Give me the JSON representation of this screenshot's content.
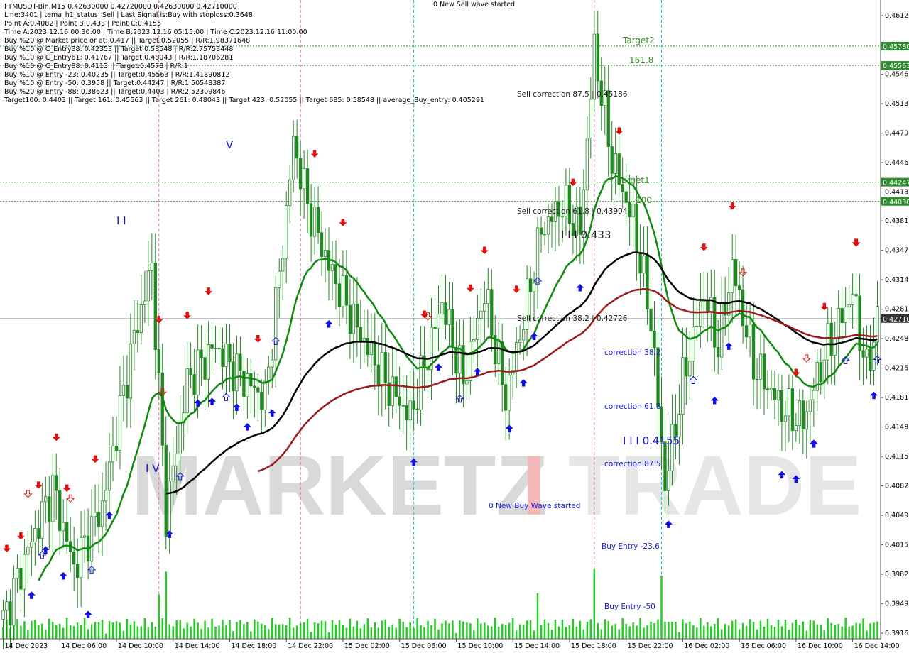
{
  "info_lines": [
    "FTMUSDT-Bin,M15  0.42630000 0.42720000 0.42630000 0.42710000",
    "Line:3401  | tema_h1_status: Sell  | Last Signal is:Buy with stoploss:0.3648",
    "Point A:0.4082 | Point B:0.433 | Point C:0.4155",
    "Time A:2023.12.16 00:30:00  | Time B:2023.12.16 05:15:00  | Time C:2023.12.16 11:00:00",
    "Buy %20 @ Market price or at: 0.417  || Target:0.52055  | R/R:1.98371648",
    "Buy %10 @ C_Entry38: 0.42353  || Target:0.58548  | R/R:2.75753448",
    "Buy %10 @ C_Entry61: 0.41767  || Target:0.48043  | R/R:1.18706281",
    "Buy %10 @ C_Entry88: 0.4113  || Target:0.4578  | R/R:1",
    "Buy %10 @ Entry -23: 0.40235  || Target:0.45563  | R/R:1.41890812",
    "Buy %10 @ Entry -50: 0.3958  || Target:0.44247  | R/R:1.50548387",
    "Buy %20 @ Entry -88: 0.38623  || Target:0.4403  | R/R:2.52309846",
    "Target100: 0.4403  || Target 161: 0.45563  || Target 261: 0.48043  || Target 423: 0.52055  || Target 685: 0.58548  || average_Buy_entry: 0.405291"
  ],
  "annotations": {
    "wave_sell": "0 New Sell wave started",
    "wave_buy": "0 New Buy Wave started",
    "target2": "Target2",
    "target2_level": "161.8",
    "target1": "Target1",
    "target1_level": "100",
    "sell_corr_875": "Sell correction 87.5 | 0.45186",
    "sell_corr_618": "Sell correction 61.8 | 0.43904",
    "sell_corr_382": "Sell correction 38.2 | 0.42726",
    "point_b": "I I I 0.433",
    "point_c": "I I I 0.4155",
    "corr_382": "correction 38.2",
    "corr_618": "correction 61.8",
    "corr_875": "correction 87.5",
    "buy_entry_23": "Buy Entry -23.6",
    "buy_entry_50": "Buy Entry -50",
    "wave_iv": "I V",
    "wave_ii": "I I",
    "wave_v": "V"
  },
  "watermark": {
    "text_dark": "MARKETZ",
    "text_red": "I",
    "text_light": "TRADE"
  },
  "colors": {
    "background": "#ffffff",
    "grid": "#d9d9d9",
    "bull_candle": "#1f8a1f",
    "bear_candle": "#1f8a1f",
    "volume": "#22cc22",
    "ema_green": "#0e8a0e",
    "ma_black": "#000000",
    "ma_red": "#9a1c1c",
    "target_line": "#2e8b2e",
    "price_tag": "#2e8b2e",
    "current_tag": "#333333",
    "buy_arrow": "#1010e0",
    "sell_arrow": "#e01010",
    "vline_pink": "#e06aa0",
    "vline_cyan": "#00cccc"
  },
  "chart_data": {
    "type": "candlestick",
    "symbol": "FTMUSDT-Bin",
    "timeframe": "M15",
    "price_axis": {
      "ylim": [
        0.391,
        0.463
      ],
      "tick_labels": [
        "0.46125",
        "0.45795",
        "0.45463",
        "0.45131",
        "0.44799",
        "0.44467",
        "0.44135",
        "0.43811",
        "0.43479",
        "0.43147",
        "0.42815",
        "0.42483",
        "0.42151",
        "0.41819",
        "0.41487",
        "0.41155",
        "0.40823",
        "0.40491",
        "0.40159",
        "0.39827",
        "0.39495",
        "0.39163"
      ],
      "tick_values": [
        0.46125,
        0.45795,
        0.45463,
        0.45131,
        0.44799,
        0.44467,
        0.44135,
        0.43811,
        0.43479,
        0.43147,
        0.42815,
        0.42483,
        0.42151,
        0.41819,
        0.41487,
        0.41155,
        0.40823,
        0.40491,
        0.40159,
        0.39827,
        0.39495,
        0.39163
      ]
    },
    "price_tags": [
      {
        "label": "0.45780",
        "value": 0.4578,
        "kind": "target"
      },
      {
        "label": "0.45563",
        "value": 0.45563,
        "kind": "target"
      },
      {
        "label": "0.44247",
        "value": 0.44247,
        "kind": "target"
      },
      {
        "label": "0.44030",
        "value": 0.4403,
        "kind": "target"
      },
      {
        "label": "0.42710",
        "value": 0.4271,
        "kind": "current"
      }
    ],
    "time_axis": {
      "labels": [
        "14 Dec 2023",
        "14 Dec 06:00",
        "14 Dec 10:00",
        "14 Dec 14:00",
        "14 Dec 18:00",
        "14 Dec 22:00",
        "15 Dec 02:00",
        "15 Dec 06:00",
        "15 Dec 10:00",
        "15 Dec 14:00",
        "15 Dec 18:00",
        "15 Dec 22:00",
        "16 Dec 02:00",
        "16 Dec 06:00",
        "16 Dec 10:00",
        "16 Dec 14:00"
      ],
      "positions_bars": [
        0,
        16,
        32,
        48,
        64,
        80,
        96,
        112,
        128,
        144,
        160,
        176,
        192,
        208,
        224,
        240
      ],
      "bars_visible": 248
    },
    "key_points": {
      "start": 0.393,
      "peaks": [
        {
          "bar": 7,
          "v": 0.401
        },
        {
          "bar": 14,
          "v": 0.408
        },
        {
          "bar": 20,
          "v": 0.399
        },
        {
          "bar": 28,
          "v": 0.406
        },
        {
          "bar": 37,
          "v": 0.425
        },
        {
          "bar": 42,
          "v": 0.433
        },
        {
          "bar": 46,
          "v": 0.405
        },
        {
          "bar": 52,
          "v": 0.42
        },
        {
          "bar": 60,
          "v": 0.424
        },
        {
          "bar": 66,
          "v": 0.421
        },
        {
          "bar": 74,
          "v": 0.418
        },
        {
          "bar": 80,
          "v": 0.439
        },
        {
          "bar": 82,
          "v": 0.447
        },
        {
          "bar": 86,
          "v": 0.44
        },
        {
          "bar": 92,
          "v": 0.433
        },
        {
          "bar": 100,
          "v": 0.426
        },
        {
          "bar": 108,
          "v": 0.42
        },
        {
          "bar": 115,
          "v": 0.416
        },
        {
          "bar": 124,
          "v": 0.429
        },
        {
          "bar": 130,
          "v": 0.42
        },
        {
          "bar": 136,
          "v": 0.43
        },
        {
          "bar": 142,
          "v": 0.418
        },
        {
          "bar": 148,
          "v": 0.429
        },
        {
          "bar": 152,
          "v": 0.437
        },
        {
          "bar": 158,
          "v": 0.44
        },
        {
          "bar": 163,
          "v": 0.437
        },
        {
          "bar": 167,
          "v": 0.4575
        },
        {
          "bar": 172,
          "v": 0.445
        },
        {
          "bar": 178,
          "v": 0.438
        },
        {
          "bar": 183,
          "v": 0.427
        },
        {
          "bar": 187,
          "v": 0.4082
        },
        {
          "bar": 192,
          "v": 0.42
        },
        {
          "bar": 198,
          "v": 0.43
        },
        {
          "bar": 202,
          "v": 0.424
        },
        {
          "bar": 206,
          "v": 0.433
        },
        {
          "bar": 212,
          "v": 0.422
        },
        {
          "bar": 220,
          "v": 0.417
        },
        {
          "bar": 226,
          "v": 0.4155
        },
        {
          "bar": 232,
          "v": 0.423
        },
        {
          "bar": 240,
          "v": 0.43
        },
        {
          "bar": 244,
          "v": 0.421
        },
        {
          "bar": 247,
          "v": 0.4271
        }
      ]
    },
    "markers": {
      "buy_solid_bars": [
        2,
        8,
        12,
        17,
        24,
        30,
        47,
        55,
        59,
        66,
        69,
        76,
        92,
        116,
        123,
        134,
        143,
        147,
        150,
        163,
        188,
        201,
        205,
        220,
        224,
        229,
        246
      ],
      "sell_solid_bars": [
        1,
        5,
        10,
        15,
        18,
        26,
        44,
        52,
        58,
        72,
        88,
        96,
        119,
        132,
        136,
        145,
        161,
        174,
        198,
        206,
        224,
        232,
        241
      ],
      "buy_hollow_bars": [
        11,
        25,
        50,
        63,
        77,
        129,
        151,
        195,
        229,
        238,
        247
      ],
      "sell_hollow_bars": [
        7,
        19,
        45,
        120,
        209,
        227,
        241
      ]
    },
    "title": "",
    "xlabel": "",
    "ylabel": ""
  }
}
